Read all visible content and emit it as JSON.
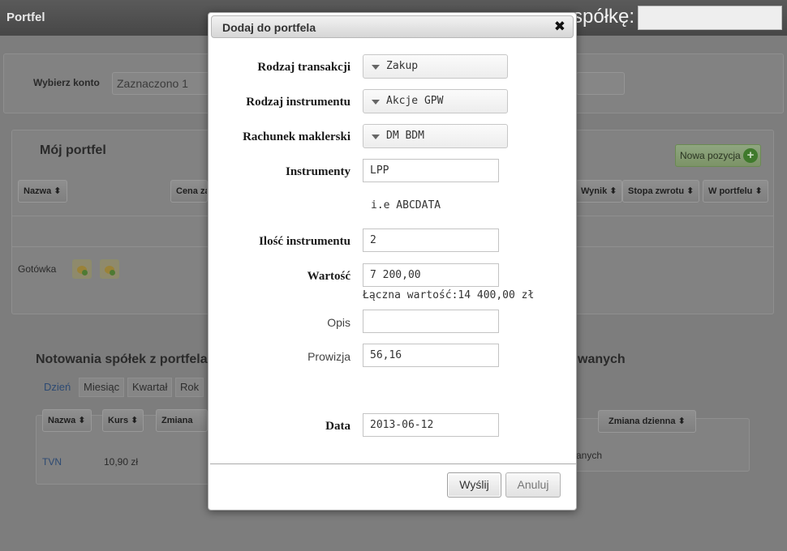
{
  "topbar": {
    "brand": "Portfel",
    "search_label": "spółkę:"
  },
  "background": {
    "account_label": "Wybierz konto",
    "account_value": "Zaznaczono 1",
    "portfolio_title": "Mój portfel",
    "new_position_label": "Nowa pozycja",
    "table_headers": [
      "Nazwa",
      "Cena za",
      "Wynik",
      "Stopa zwrotu",
      "W portfelu"
    ],
    "cash_label": "Gotówka",
    "quotes_title": "Notowania spółek z portfela",
    "quotes_title_right": "wanych",
    "period_tabs": [
      "Dzień",
      "Miesiąc",
      "Kwartał",
      "Rok"
    ],
    "quotes_headers": [
      "Nazwa",
      "Kurs",
      "Zmiana",
      "Zmiana dzienna"
    ],
    "quote_row": {
      "name": "TVN",
      "price": "10,90 zł"
    },
    "right_text": "anych"
  },
  "modal": {
    "title": "Dodaj do portfela",
    "close_symbol": "✖",
    "fields": {
      "transaction_type": {
        "label": "Rodzaj transakcji",
        "value": "Zakup"
      },
      "instrument_type": {
        "label": "Rodzaj instrumentu",
        "value": "Akcje GPW"
      },
      "brokerage_account": {
        "label": "Rachunek maklerski",
        "value": "DM BDM"
      },
      "instrument": {
        "label": "Instrumenty",
        "value": "LPP",
        "hint": "i.e ABCDATA"
      },
      "quantity": {
        "label": "Ilość instrumentu",
        "value": "2"
      },
      "value": {
        "label": "Wartość",
        "value": "7 200,00",
        "total": "Łączna wartość:14 400,00 zł"
      },
      "description": {
        "label": "Opis",
        "value": ""
      },
      "commission": {
        "label": "Prowizja",
        "value": "56,16"
      },
      "date": {
        "label": "Data",
        "value": "2013-06-12"
      }
    },
    "submit_label": "Wyślij",
    "cancel_label": "Anuluj"
  }
}
